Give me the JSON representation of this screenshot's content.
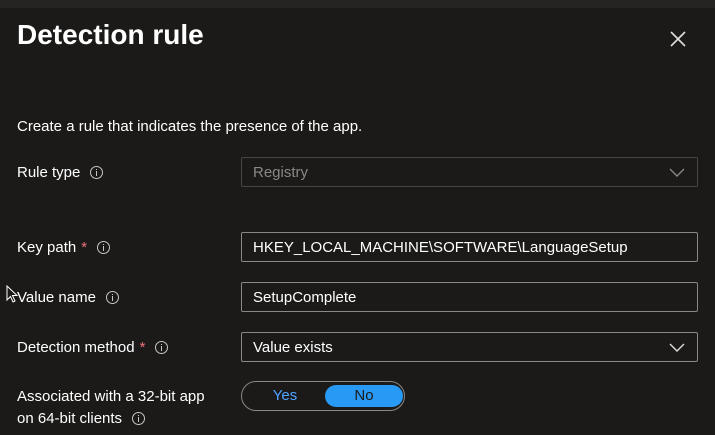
{
  "panel": {
    "title": "Detection rule",
    "subtitle": "Create a rule that indicates the presence of the app."
  },
  "fields": {
    "rule_type": {
      "label": "Rule type",
      "value": "Registry"
    },
    "key_path": {
      "label": "Key path",
      "required_mark": "*",
      "value": "HKEY_LOCAL_MACHINE\\SOFTWARE\\LanguageSetup"
    },
    "value_name": {
      "label": "Value name",
      "value": "SetupComplete"
    },
    "detection_method": {
      "label": "Detection method",
      "required_mark": "*",
      "value": "Value exists"
    },
    "associated_32bit": {
      "label_line1": "Associated with a 32-bit app",
      "label_line2": "on 64-bit clients",
      "option_yes": "Yes",
      "option_no": "No",
      "selected": "No"
    }
  },
  "icons": {
    "close": "close-icon",
    "info": "info-icon",
    "dropdown": "chevron-down-icon",
    "pointer": "mouse-pointer-icon"
  },
  "colors": {
    "background": "#1b1a19",
    "accent": "#2899f5",
    "required": "#f1707b",
    "border": "#8a8886"
  }
}
